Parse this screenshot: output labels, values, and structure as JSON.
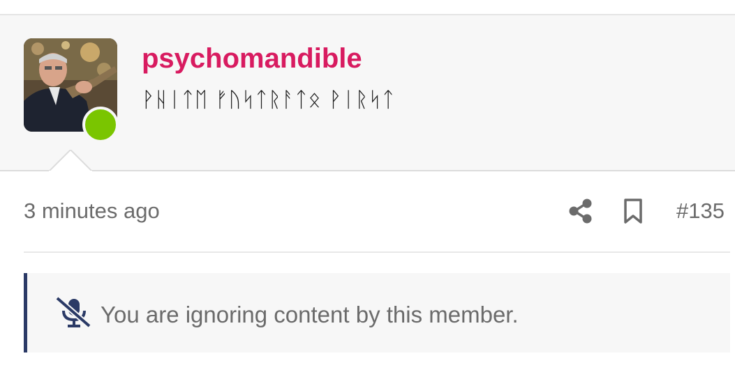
{
  "post": {
    "author": {
      "username": "psychomandible",
      "title": "ᚹᚺᛁᛏᛖ ᚠᚢᛋᛏᚱᚨᛏᛟ ᚹᛁᚱᛋᛏ",
      "online": true,
      "online_color": "#7ac500",
      "username_color": "#d81b60"
    },
    "meta": {
      "timestamp": "3 minutes ago",
      "post_number": "#135",
      "icons": [
        "share-icon",
        "bookmark-icon"
      ]
    },
    "ignored_notice": {
      "icon": "mute-microphone-icon",
      "message": "You are ignoring content by this member.",
      "accent_color": "#2b3a66"
    }
  }
}
